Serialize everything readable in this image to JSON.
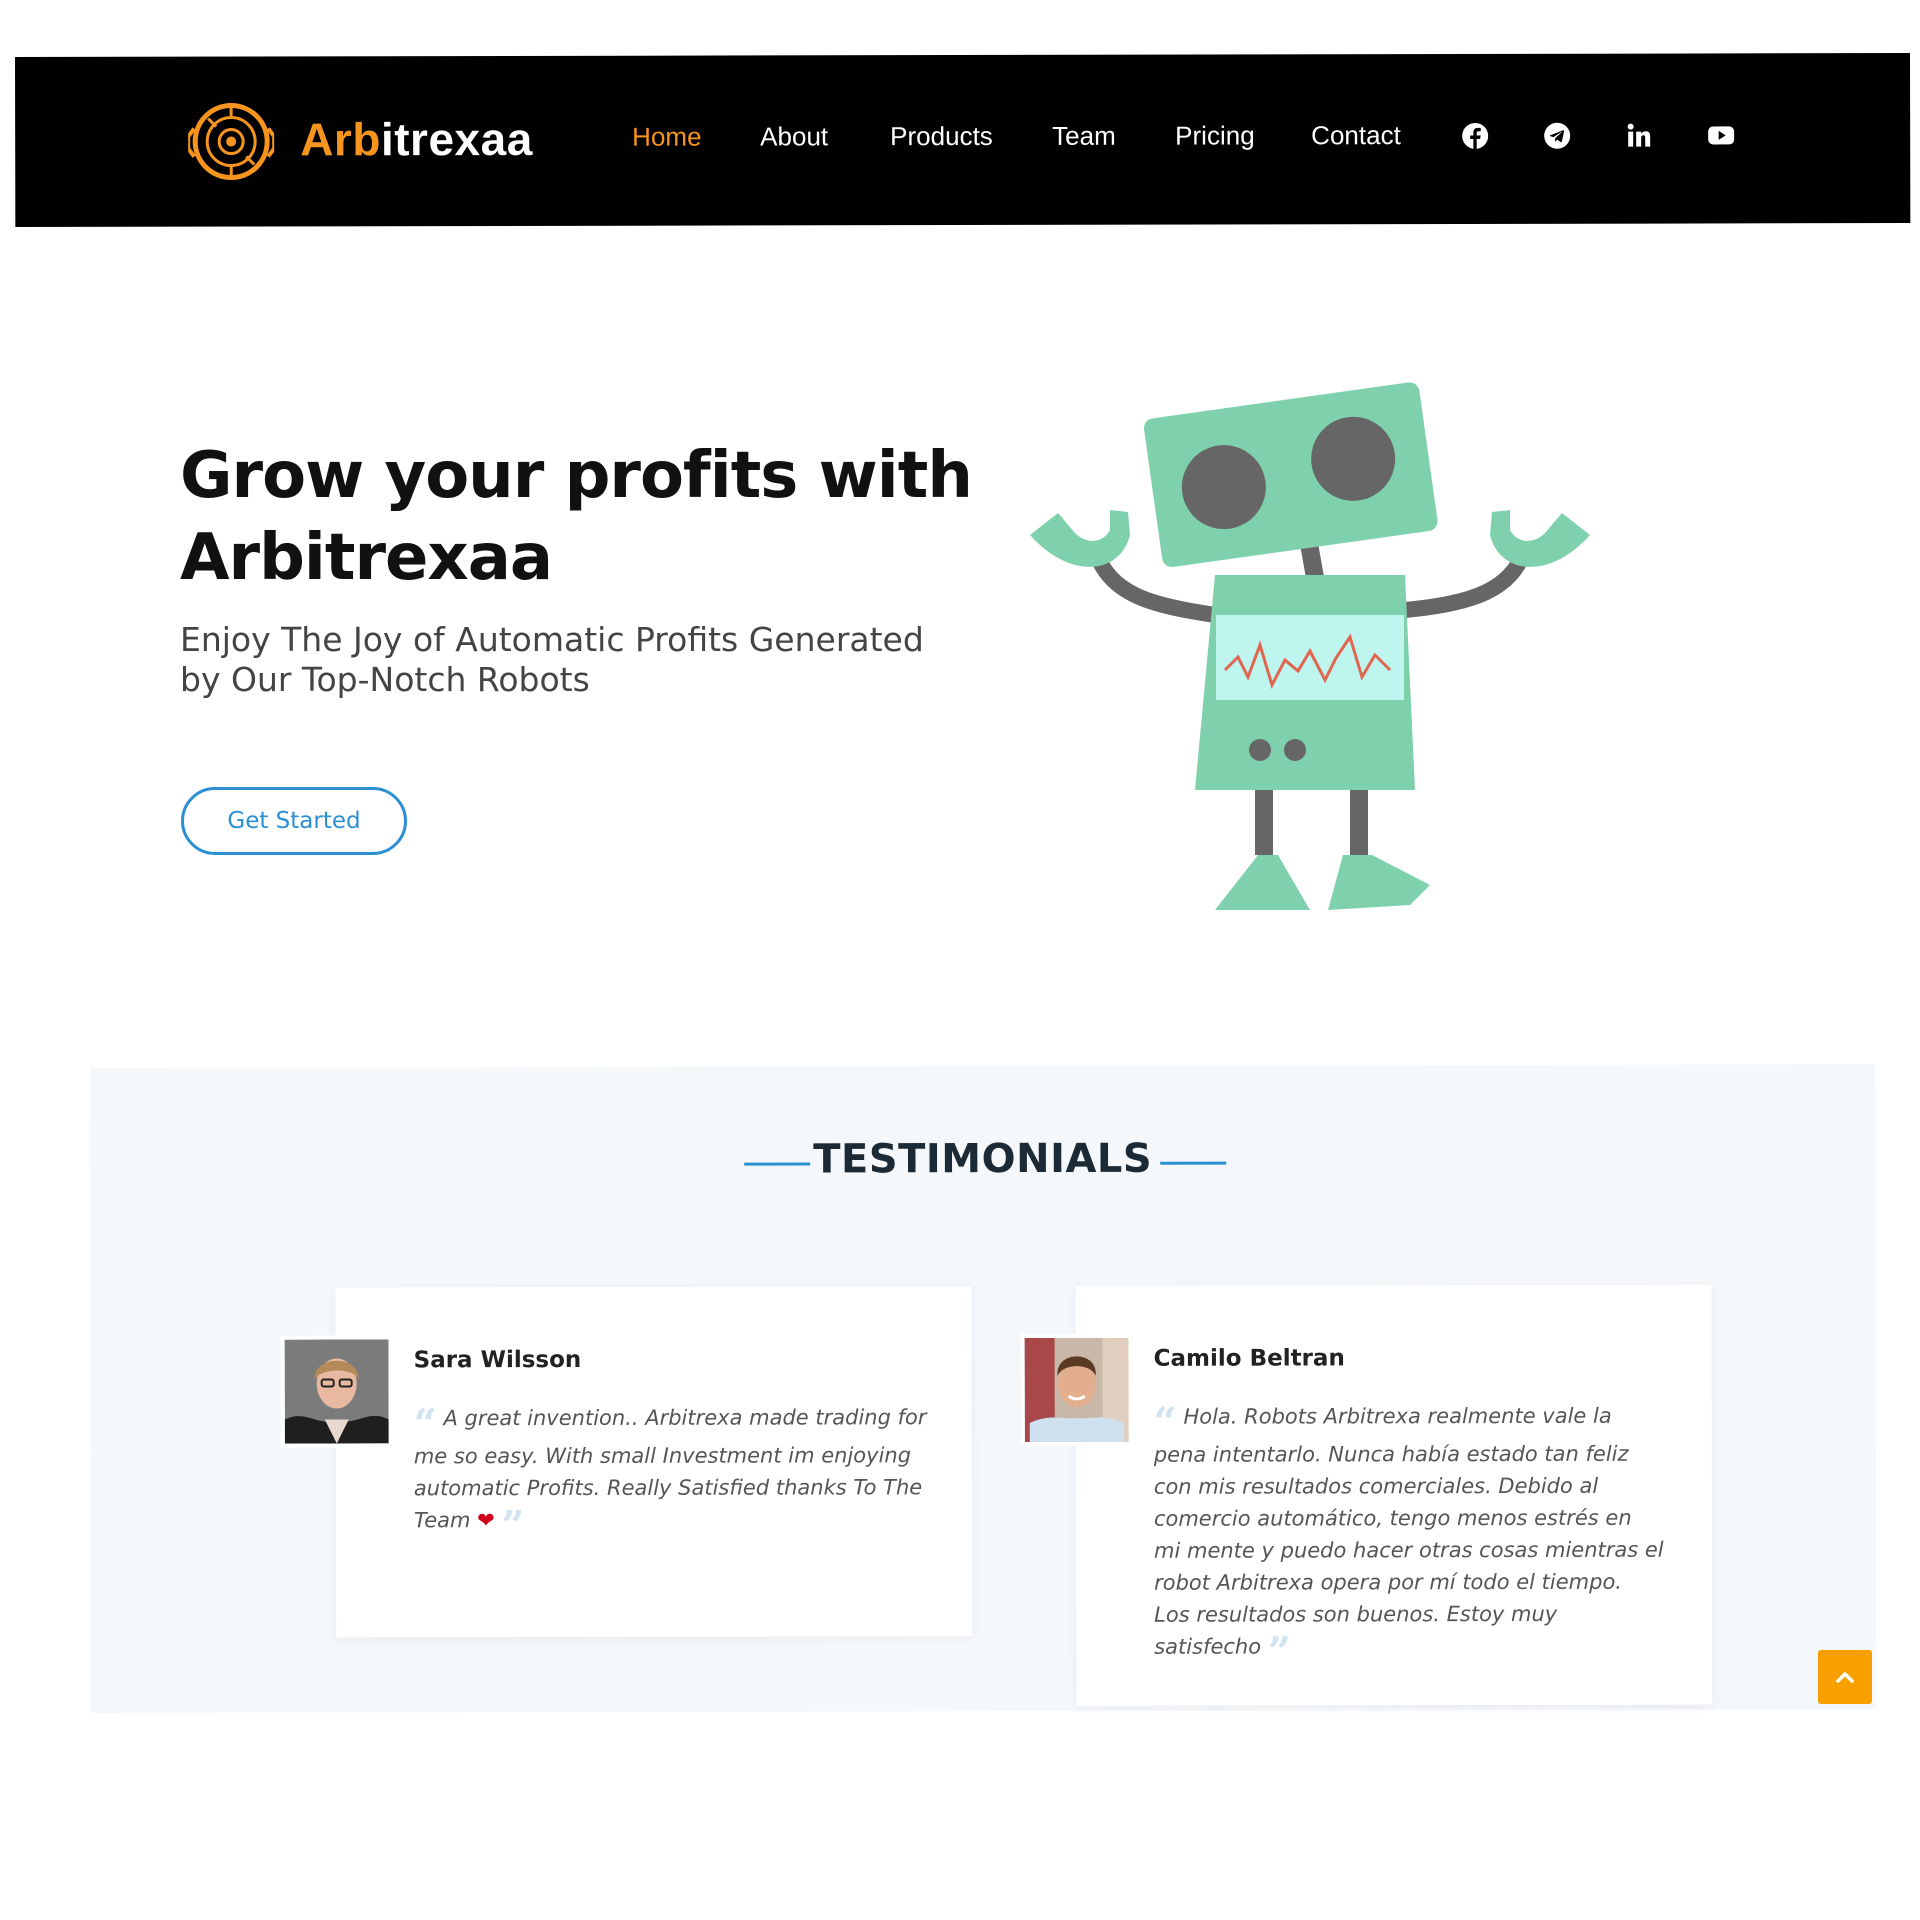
{
  "header": {
    "brand_part1": "Arb",
    "brand_part2": "itrexaa",
    "nav": [
      "Home",
      "About",
      "Products",
      "Team",
      "Pricing",
      "Contact"
    ],
    "social_icons": [
      "facebook-icon",
      "telegram-icon",
      "linkedin-icon",
      "youtube-icon"
    ]
  },
  "hero": {
    "title": "Grow your profits with Arbitrexaa",
    "subtitle": "Enjoy The Joy of Automatic Profits Generated by Our Top-Notch Robots",
    "cta_label": "Get Started"
  },
  "testimonials": {
    "heading": "TESTIMONIALS",
    "items": [
      {
        "name": "Sara Wilsson",
        "quote": "A great invention.. Arbitrexa made trading for me so easy. With small Investment im enjoying automatic Profits. Really Satisfied thanks To The Team"
      },
      {
        "name": "Camilo Beltran",
        "quote": "Hola. Robots Arbitrexa realmente vale la pena intentarlo. Nunca había estado tan feliz con mis resultados comerciales. Debido al comercio automático, tengo menos estrés en mi mente y puedo hacer otras cosas mientras el robot Arbitrexa opera por mí todo el tiempo. Los resultados son buenos. Estoy muy satisfecho"
      }
    ]
  },
  "colors": {
    "accent_orange": "#f7941d",
    "link_blue": "#2b8fd3",
    "robot_green": "#7fd1ae",
    "robot_gray": "#666666",
    "header_bg": "#000000",
    "testimonials_bg": "#f4f8fb"
  }
}
